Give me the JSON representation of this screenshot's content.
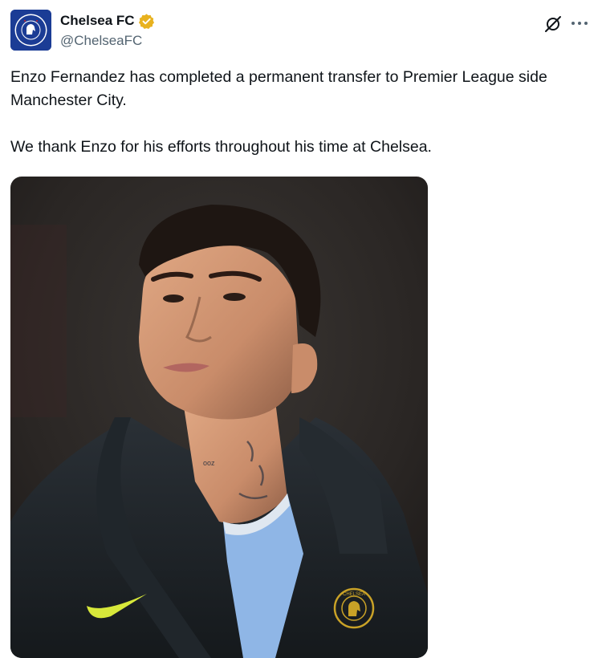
{
  "author": {
    "display_name": "Chelsea FC",
    "handle": "@ChelseaFC",
    "verified": true,
    "verified_color": "#e8b21f",
    "avatar_color": "#1b3c95"
  },
  "icons": {
    "grok": "grok-icon",
    "more": "more-icon",
    "verified": "verified-badge-icon"
  },
  "tweet": {
    "paragraphs": [
      "Enzo Fernandez has completed a permanent transfer to Premier League side Manchester City.",
      "We thank Enzo for his efforts throughout his time at Chelsea."
    ]
  },
  "media": {
    "alt": "Photo of Enzo Fernandez looking up, wearing a dark Chelsea jacket",
    "crest_text": "CHELSEA",
    "crest_color": "#c9a227",
    "jacket_color": "#1f2428",
    "shirt_color": "#8fb6e6",
    "logo_color": "#d7e83a"
  }
}
